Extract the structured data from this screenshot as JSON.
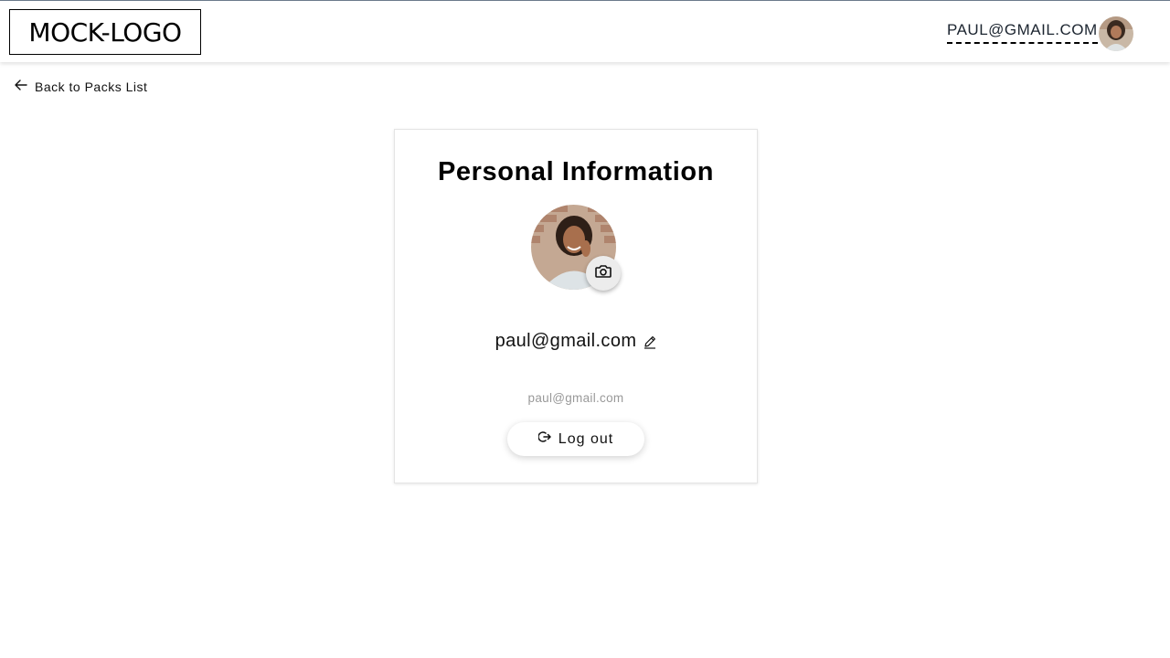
{
  "header": {
    "logo_text": "MOCK-LOGO",
    "user_email": "PAUL@GMAIL.COM",
    "avatar_icon": "user-avatar-photo"
  },
  "nav": {
    "back_label": "Back to Packs List",
    "back_icon": "arrow-left-icon"
  },
  "profile": {
    "title": "Personal Information",
    "name": "paul@gmail.com",
    "email": "paul@gmail.com",
    "camera_icon": "camera-icon",
    "edit_icon": "pencil-icon",
    "logout_label": "Log out",
    "logout_icon": "logout-icon"
  },
  "colors": {
    "background": "#ffffff",
    "header_border": "#6b7b8c",
    "secondary_text": "#999999",
    "card_border": "#e4e4e4"
  }
}
